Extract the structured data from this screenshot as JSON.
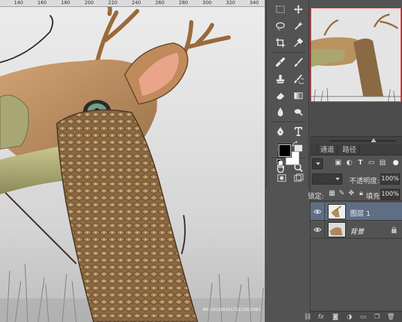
{
  "ruler": {
    "ticks": [
      "140",
      "160",
      "180",
      "200",
      "220",
      "240",
      "260",
      "280",
      "300",
      "320",
      "340"
    ]
  },
  "canvas": {
    "watermark": "N0:20110910175222022082"
  },
  "tools": {
    "items": [
      "rect-marquee",
      "move",
      "lasso",
      "magic-wand",
      "crop",
      "eyedropper",
      "healing",
      "brush",
      "clone-stamp",
      "history-brush",
      "eraser",
      "gradient",
      "blur",
      "dodge",
      "pen",
      "type",
      "path-select",
      "shape",
      "hand",
      "zoom"
    ],
    "foreground_color": "#000000",
    "background_color": "#ffffff"
  },
  "layers_panel": {
    "tabs": [
      "通道",
      "路径"
    ],
    "filter_kind": "",
    "opacity_label": "不透明度:",
    "opacity_value": "100%",
    "lock_label": "锁定:",
    "fill_label": "填充:",
    "fill_value": "100%",
    "layers": [
      {
        "name": "图层 1",
        "selected": true,
        "italic": false,
        "locked": false
      },
      {
        "name": "背景",
        "selected": false,
        "italic": true,
        "locked": true
      }
    ]
  },
  "colors": {
    "panel_bg": "#535353",
    "selected_layer": "#5f6e85",
    "navigator_frame": "#e0282a"
  }
}
